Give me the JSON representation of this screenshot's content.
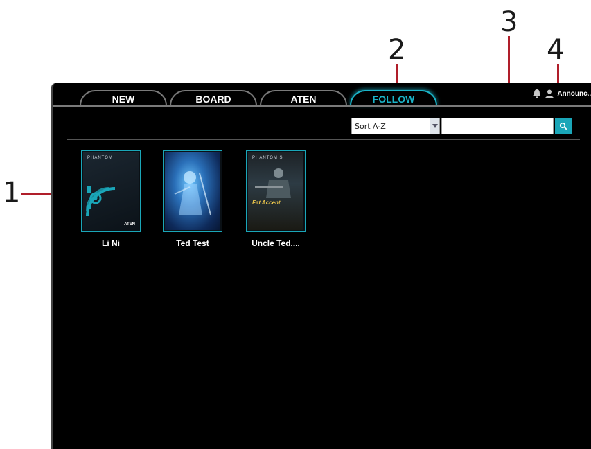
{
  "callouts": [
    "1",
    "2",
    "3",
    "4"
  ],
  "tabs": [
    {
      "label": "NEW",
      "active": false
    },
    {
      "label": "BOARD",
      "active": false
    },
    {
      "label": "ATEN",
      "active": false
    },
    {
      "label": "FOLLOW",
      "active": true
    }
  ],
  "header": {
    "bell_icon": "bell-icon",
    "user_icon": "user-icon",
    "username": "Announc..."
  },
  "controls": {
    "sort_value": "Sort A-Z",
    "search_value": "",
    "search_placeholder": "",
    "search_icon": "search-icon"
  },
  "cards": [
    {
      "name": "Li Ni",
      "cover_brand_top": "PHANTOM",
      "cover_brand_bottom": "ATEN"
    },
    {
      "name": "Ted Test"
    },
    {
      "name": "Uncle Ted....",
      "cover_brand_top": "PHANTOM S",
      "cover_title": "Fat Accent"
    }
  ],
  "colors": {
    "accent": "#1aa6b8",
    "background": "#000000",
    "callout_line": "#b01e2a"
  }
}
